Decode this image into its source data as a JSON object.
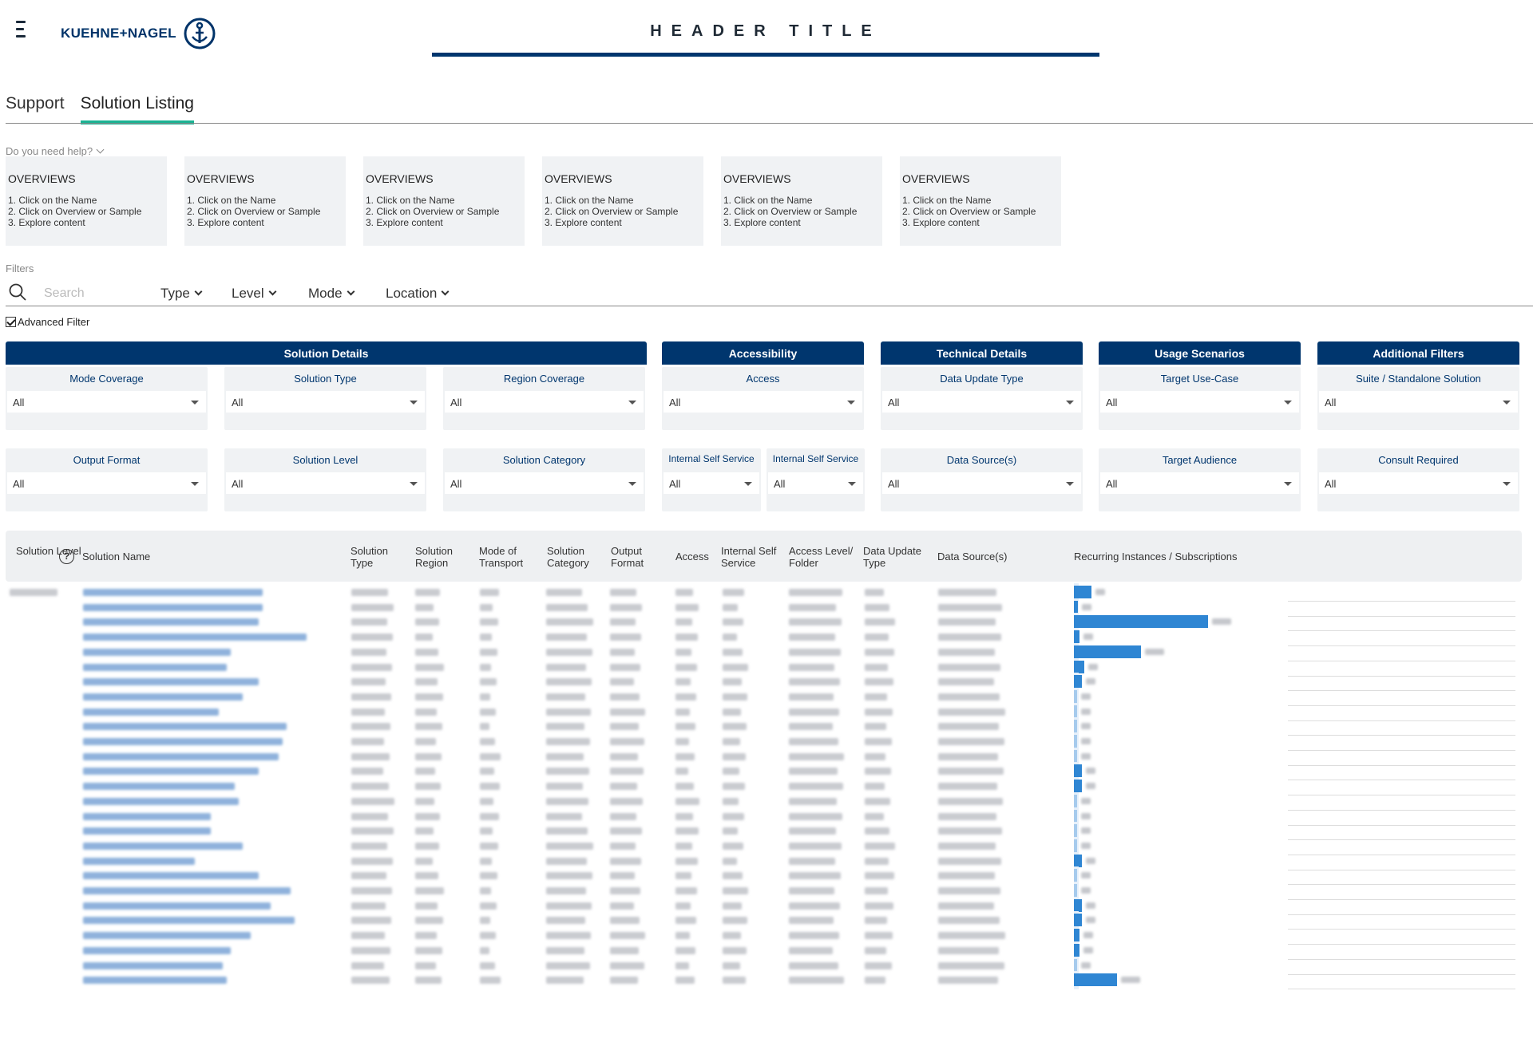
{
  "header": {
    "logo_text": "KUEHNE+NAGEL",
    "title": "HEADER TITLE"
  },
  "tabs": [
    {
      "label": "Support",
      "active": false
    },
    {
      "label": "Solution Listing",
      "active": true
    }
  ],
  "help_toggle": "Do you need help?",
  "overview_cards": [
    {
      "title": "OVERVIEWS",
      "steps": [
        "1. Click on the Name",
        "2. Click on Overview or Sample",
        "3. Explore content"
      ]
    },
    {
      "title": "OVERVIEWS",
      "steps": [
        "1. Click on the Name",
        "2. Click on Overview or Sample",
        "3. Explore content"
      ]
    },
    {
      "title": "OVERVIEWS",
      "steps": [
        "1. Click on the Name",
        "2. Click on Overview or Sample",
        "3. Explore content"
      ]
    },
    {
      "title": "OVERVIEWS",
      "steps": [
        "1. Click on the Name",
        "2. Click on Overview or Sample",
        "3. Explore content"
      ]
    },
    {
      "title": "OVERVIEWS",
      "steps": [
        "1. Click on the Name",
        "2. Click on Overview or Sample",
        "3. Explore content"
      ]
    },
    {
      "title": "OVERVIEWS",
      "steps": [
        "1. Click on the Name",
        "2. Click on Overview or Sample",
        "3. Explore content"
      ]
    }
  ],
  "filters": {
    "label": "Filters",
    "search_placeholder": "Search",
    "dropdowns": [
      "Type",
      "Level",
      "Mode",
      "Location"
    ],
    "advanced_filter_label": "Advanced Filter",
    "advanced_filter_checked": true
  },
  "filter_groups": [
    {
      "title": "Solution Details",
      "fields": [
        "Mode Coverage",
        "Solution Type",
        "Region Coverage",
        "Output Format",
        "Solution Level",
        "Solution Category"
      ]
    },
    {
      "title": "Accessibility",
      "fields": [
        "Access",
        "Internal Self Service",
        "Internal Self Service"
      ]
    },
    {
      "title": "Technical Details",
      "fields": [
        "Data Update Type",
        "Data Source(s)"
      ]
    },
    {
      "title": "Usage Scenarios",
      "fields": [
        "Target Use-Case",
        "Target Audience"
      ]
    },
    {
      "title": "Additional Filters",
      "fields": [
        "Suite / Standalone Solution",
        "Consult Required"
      ]
    }
  ],
  "filter_value": "All",
  "table": {
    "columns": [
      "Solution Level",
      "Solution Name",
      "Solution Type",
      "Solution Region",
      "Mode of Transport",
      "Solution Category",
      "Output Format",
      "Access",
      "Internal Self Service",
      "Access Level/ Folder",
      "Data Update Type",
      "Data Source(s)",
      "Recurring Instances / Subscriptions"
    ],
    "help_icon": "?",
    "recurring_fraction": [
      0.13,
      0.03,
      1.0,
      0.04,
      0.5,
      0.08,
      0.06,
      0.0,
      0.0,
      0.0,
      0.0,
      0.0,
      0.06,
      0.06,
      0.0,
      0.0,
      0.0,
      0.0,
      0.06,
      0.0,
      0.0,
      0.06,
      0.06,
      0.04,
      0.04,
      0.0,
      0.32
    ]
  }
}
